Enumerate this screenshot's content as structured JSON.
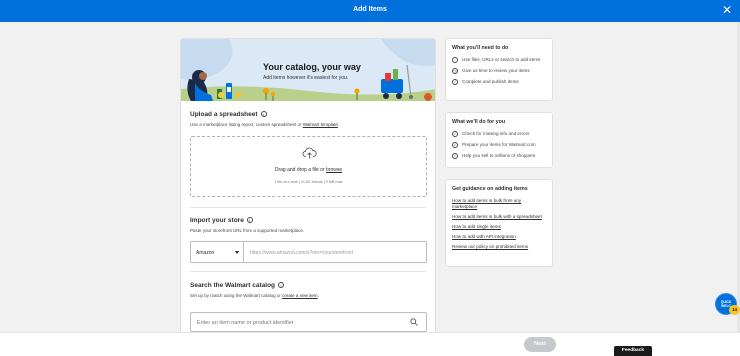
{
  "header": {
    "title": "Add Items",
    "close_icon": "close-icon"
  },
  "hero": {
    "title": "Your catalog, your way",
    "subtitle": "Add items however it's easiest for you."
  },
  "upload": {
    "title": "Upload a spreadsheet",
    "desc_prefix": "Use a marketplace listing report, custom spreadsheet or ",
    "desc_link": "Walmart template",
    "desc_suffix": ".",
    "drop_prefix": "Drag and drop a file or ",
    "drop_link": "browse",
    "drop_limits": "1 file at a time | XLSX format | 5 MB max"
  },
  "import": {
    "title": "Import your store",
    "desc": "Paste your storefront URL from a supported marketplace.",
    "marketplace": "Amazon",
    "url_placeholder": "https://www.amazon.com/s?me=yourstorefront"
  },
  "catalog": {
    "title": "Search the Walmart catalog",
    "desc_prefix": "Set up by match using the Walmart catalog or ",
    "desc_link": "create a new item",
    "desc_suffix": ".",
    "search_placeholder": "Enter an item name or product identifier"
  },
  "need": {
    "title": "What you'll need to do",
    "items": [
      "Use files, URLs or search to add items",
      "Give us time to review your items",
      "Complete and publish items"
    ]
  },
  "wedo": {
    "title": "What we'll do for you",
    "items": [
      "Check for missing info and errors",
      "Prepare your items for Walmart.com",
      "Help you sell to millions of shoppers"
    ]
  },
  "guidance": {
    "title": "Get guidance on adding items",
    "links": [
      "How to add items in bulk from any marketplace",
      "How to add items in bulk with a spreadsheet",
      "How to add single items",
      "How to add with API integration",
      "Review our policy on prohibited items"
    ]
  },
  "footer": {
    "next": "Next",
    "feedback": "Feedback"
  },
  "quick_widget": {
    "line1": "QUICK",
    "line2": "WELC",
    "badge": "14"
  },
  "colors": {
    "brand_blue": "#0071dc",
    "yellow": "#ffc220"
  }
}
